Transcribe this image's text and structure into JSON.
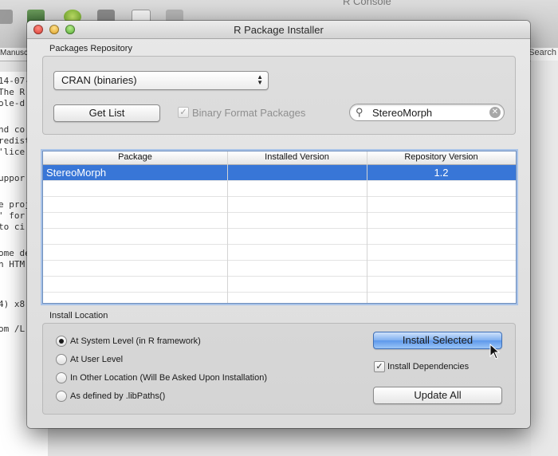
{
  "background": {
    "title": "R Console",
    "tab_label": "Manuscr",
    "search_label": "Search",
    "console_lines": [
      "14-07-",
      "The R",
      "ole-d",
      "",
      "nd co",
      "redist",
      "'lice",
      "",
      "uppor",
      "",
      "e proj",
      "' for",
      "to ci",
      "",
      "ome de",
      "n HTM",
      "",
      "4) x8",
      "",
      "om /L"
    ]
  },
  "window": {
    "title": "R Package Installer"
  },
  "repository": {
    "group_label": "Packages Repository",
    "popup_value": "CRAN (binaries)",
    "get_list_label": "Get List",
    "binary_format_label": "Binary Format Packages",
    "binary_format_checked": true,
    "search_value": "StereoMorph"
  },
  "table": {
    "columns": [
      "Package",
      "Installed Version",
      "Repository Version"
    ],
    "rows": [
      {
        "package": "StereoMorph",
        "installed": "",
        "repository": "1.2",
        "selected": true
      }
    ]
  },
  "install_location": {
    "group_label": "Install Location",
    "options": [
      {
        "label": "At System Level (in R framework)",
        "selected": true
      },
      {
        "label": "At User Level",
        "selected": false
      },
      {
        "label": "In Other Location (Will Be Asked Upon Installation)",
        "selected": false
      },
      {
        "label": "As defined by .libPaths()",
        "selected": false
      }
    ],
    "install_selected_label": "Install Selected",
    "install_dependencies_label": "Install Dependencies",
    "install_dependencies_checked": true,
    "update_all_label": "Update All"
  },
  "colors": {
    "selection": "#3876d7",
    "primary_button": "#5d98eb"
  }
}
